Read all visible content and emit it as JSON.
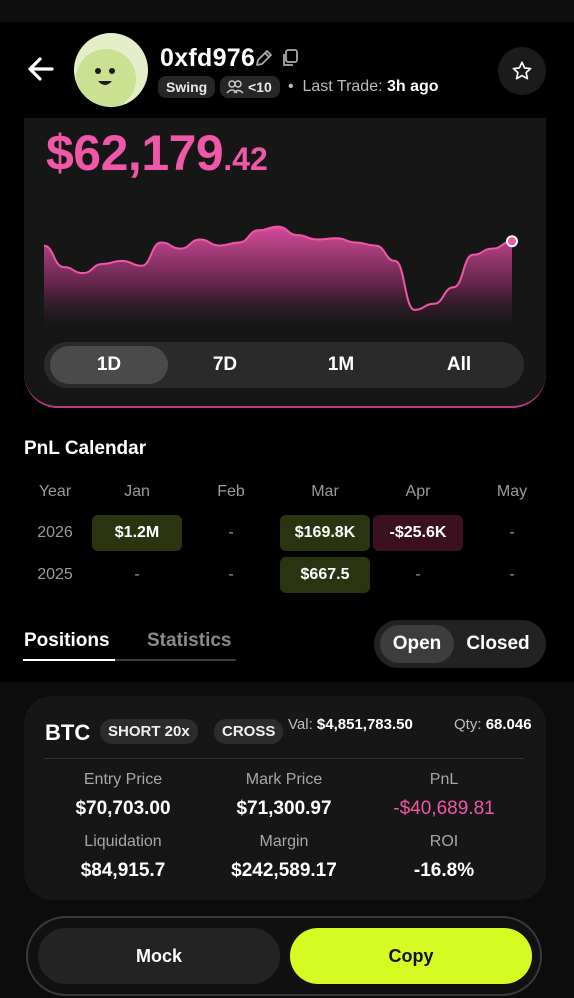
{
  "header": {
    "trader_name": "0xfd976",
    "style_badge": "Swing",
    "followers_badge": "<10",
    "last_trade_label": "Last Trade:",
    "last_trade_value": "3h ago"
  },
  "portfolio": {
    "value_int": "$62,179",
    "value_dec": ".42",
    "ranges": [
      "1D",
      "7D",
      "1M",
      "All"
    ],
    "active_range": "1D",
    "line_color": "#f057a8"
  },
  "chart_data": {
    "type": "area",
    "x": [
      0,
      1,
      2,
      3,
      4,
      5,
      6,
      7,
      8,
      9,
      10,
      11,
      12,
      13,
      14,
      15,
      16,
      17,
      18,
      19,
      20,
      21,
      22,
      23,
      24
    ],
    "values": [
      61.5,
      58,
      57,
      58.5,
      59,
      58.2,
      62,
      61,
      62.5,
      61.5,
      62,
      64,
      64.6,
      63.2,
      62.5,
      62.7,
      62,
      61.5,
      59,
      51,
      52,
      54.7,
      60,
      61,
      62.2
    ],
    "title": "",
    "xlabel": "",
    "ylabel": ""
  },
  "calendar": {
    "title": "PnL Calendar",
    "headers": [
      "Year",
      "Jan",
      "Feb",
      "Mar",
      "Apr",
      "May"
    ],
    "rows": [
      {
        "year": "2026",
        "cells": [
          "$1.2M",
          "-",
          "$169.8K",
          "-$25.6K",
          "-"
        ]
      },
      {
        "year": "2025",
        "cells": [
          "-",
          "-",
          "$667.5",
          "-",
          "-"
        ]
      }
    ]
  },
  "tabs": {
    "positions": "Positions",
    "statistics": "Statistics",
    "open": "Open",
    "closed": "Closed"
  },
  "position": {
    "coin": "BTC",
    "side_badge": "SHORT 20x",
    "margin_badge": "CROSS",
    "val_label": "Val:",
    "val_value": "$4,851,783.50",
    "qty_label": "Qty:",
    "qty_value": "68.046",
    "entry_label": "Entry Price",
    "entry_value": "$70,703.00",
    "mark_label": "Mark Price",
    "mark_value": "$71,300.97",
    "pnl_label": "PnL",
    "pnl_value": "-$40,689.81",
    "liq_label": "Liquidation",
    "liq_value": "$84,915.7",
    "margin_label": "Margin",
    "margin_value": "$242,589.17",
    "roi_label": "ROI",
    "roi_value": "-16.8%"
  },
  "actions": {
    "mock": "Mock",
    "copy": "Copy",
    "copy_color": "#d6fb22"
  }
}
